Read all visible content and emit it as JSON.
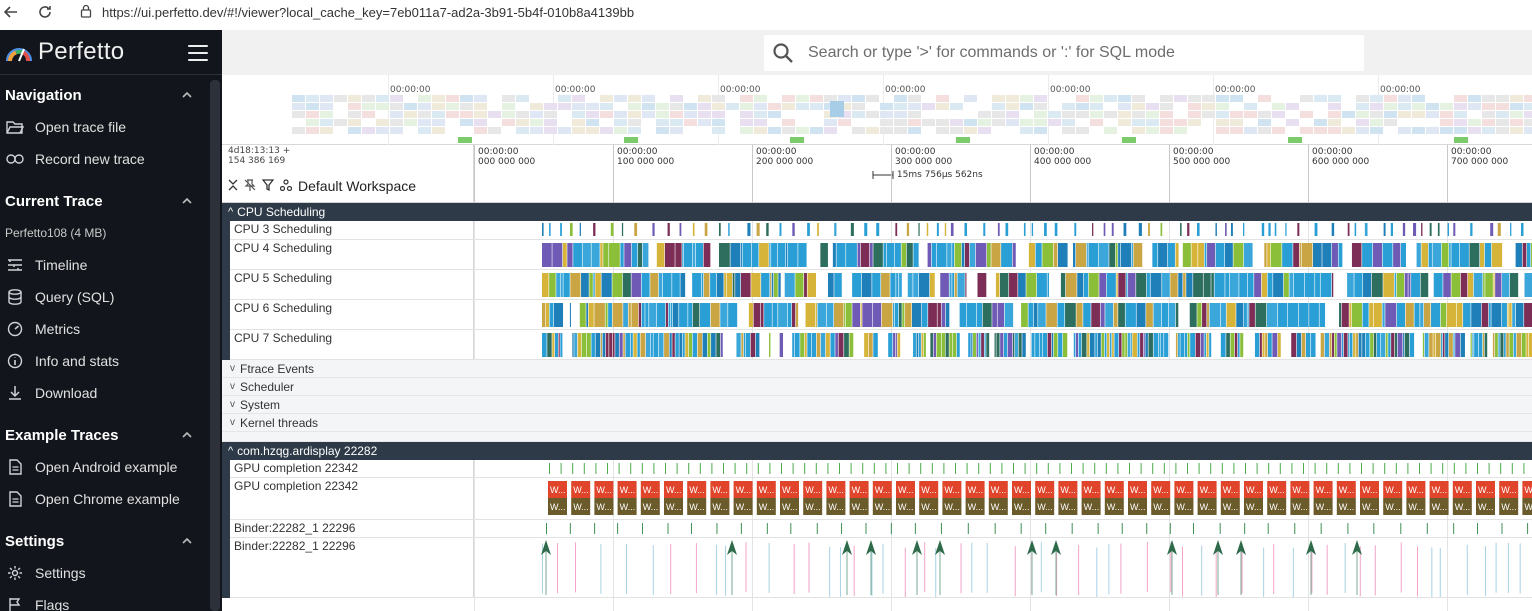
{
  "browser": {
    "url": "https://ui.perfetto.dev/#!/viewer?local_cache_key=7eb011a7-ad2a-3b91-5b4f-010b8a4139bb"
  },
  "sidebar": {
    "brand": "Perfetto",
    "sections": [
      {
        "title": "Navigation",
        "items": [
          {
            "label": "Open trace file",
            "icon": "folder-open-icon"
          },
          {
            "label": "Record new trace",
            "icon": "record-icon"
          }
        ]
      },
      {
        "title": "Current Trace",
        "subtitle": "Perfetto108 (4 MB)",
        "items": [
          {
            "label": "Timeline",
            "icon": "timeline-icon"
          },
          {
            "label": "Query (SQL)",
            "icon": "database-icon"
          },
          {
            "label": "Metrics",
            "icon": "speedometer-icon"
          },
          {
            "label": "Info and stats",
            "icon": "info-icon"
          },
          {
            "label": "Download",
            "icon": "download-icon"
          }
        ]
      },
      {
        "title": "Example Traces",
        "items": [
          {
            "label": "Open Android example",
            "icon": "document-icon"
          },
          {
            "label": "Open Chrome example",
            "icon": "document-icon"
          }
        ]
      },
      {
        "title": "Settings",
        "items": [
          {
            "label": "Settings",
            "icon": "gear-icon"
          },
          {
            "label": "Flags",
            "icon": "flag-icon"
          }
        ]
      }
    ]
  },
  "search": {
    "placeholder": "Search or type '>' for commands or ':' for SQL mode"
  },
  "overview": {
    "tick_labels": [
      "00:00:00",
      "00:00:00",
      "00:00:00",
      "00:00:00",
      "00:00:00",
      "00:00:00",
      "00:00:00"
    ]
  },
  "ruler": {
    "timestamp_line1": "4d18:13:13  +",
    "timestamp_line2": "154 386 169",
    "workspace": "Default Workspace",
    "measurement": "15ms 756µs 562ns",
    "ticks": [
      {
        "top": "00:00:00",
        "bottom": "000 000 000"
      },
      {
        "top": "00:00:00",
        "bottom": "100 000 000"
      },
      {
        "top": "00:00:00",
        "bottom": "200 000 000"
      },
      {
        "top": "00:00:00",
        "bottom": "300 000 000"
      },
      {
        "top": "00:00:00",
        "bottom": "400 000 000"
      },
      {
        "top": "00:00:00",
        "bottom": "500 000 000"
      },
      {
        "top": "00:00:00",
        "bottom": "600 000 000"
      },
      {
        "top": "00:00:00",
        "bottom": "700 000 000"
      }
    ]
  },
  "groups": {
    "cpu": {
      "title": "CPU Scheduling",
      "tracks": [
        "CPU 3 Scheduling",
        "CPU 4 Scheduling",
        "CPU 5 Scheduling",
        "CPU 6 Scheduling",
        "CPU 7 Scheduling"
      ]
    },
    "collapsed": [
      "Ftrace Events",
      "Scheduler",
      "System",
      "Kernel threads"
    ],
    "process": {
      "title": "com.hzqg.ardisplay 22282",
      "tracks": [
        "GPU completion 22342",
        "GPU completion 22342",
        "Binder:22282_1 22296",
        "Binder:22282_1 22296"
      ],
      "slice_label": "W..."
    }
  },
  "colors": {
    "sidebar_bg": "#12161c",
    "group_header": "#2e3a47",
    "cpu_primary": "#2a9fd6",
    "slice_red": "#e0452b",
    "slice_olive": "#6b5a2a",
    "binder_arrow": "#2f6b4a"
  }
}
